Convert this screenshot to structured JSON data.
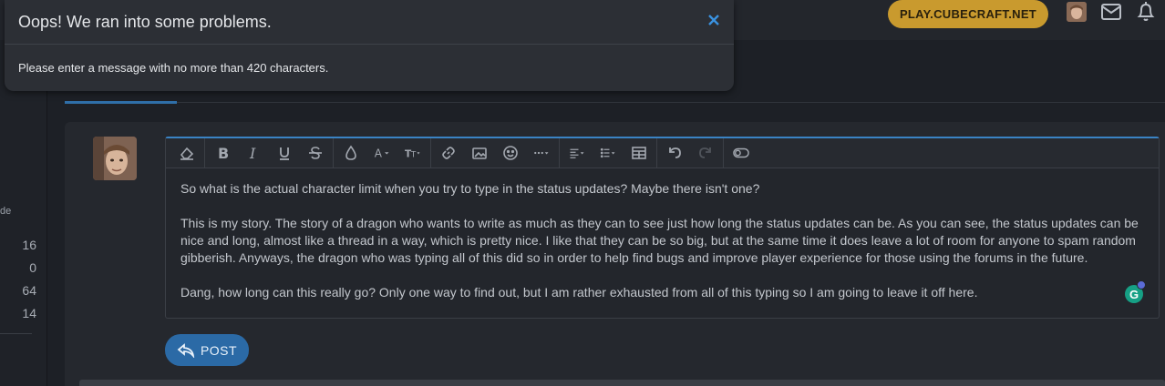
{
  "header": {
    "server_button": "PLAY.CUBECRAFT.NET"
  },
  "sidebar": {
    "partial_text": "de",
    "stats": [
      "16",
      "0",
      "64",
      "14"
    ]
  },
  "editor": {
    "paragraphs": [
      "So what is the actual character limit when you try to type in the status updates? Maybe there isn't one?",
      "This is my story. The story of a dragon who wants to write as much as they can to see just how long the status updates can be. As you can see, the status updates can be nice and long, almost like a thread in a way, which is pretty nice. I like that they can be so big, but at the same time it does leave a lot of room for anyone to spam random gibberish. Anyways, the dragon who was typing all of this did so in order to help find bugs and improve player experience for those using the forums in the future.",
      "Dang, how long can this really go? Only one way to find out, but I am rather exhausted from all of this typing so I am going to leave it off here."
    ],
    "grammarly_letter": "G",
    "post_label": "POST"
  },
  "modal": {
    "title": "Oops! We ran into some problems.",
    "message": "Please enter a message with no more than 420 characters."
  }
}
